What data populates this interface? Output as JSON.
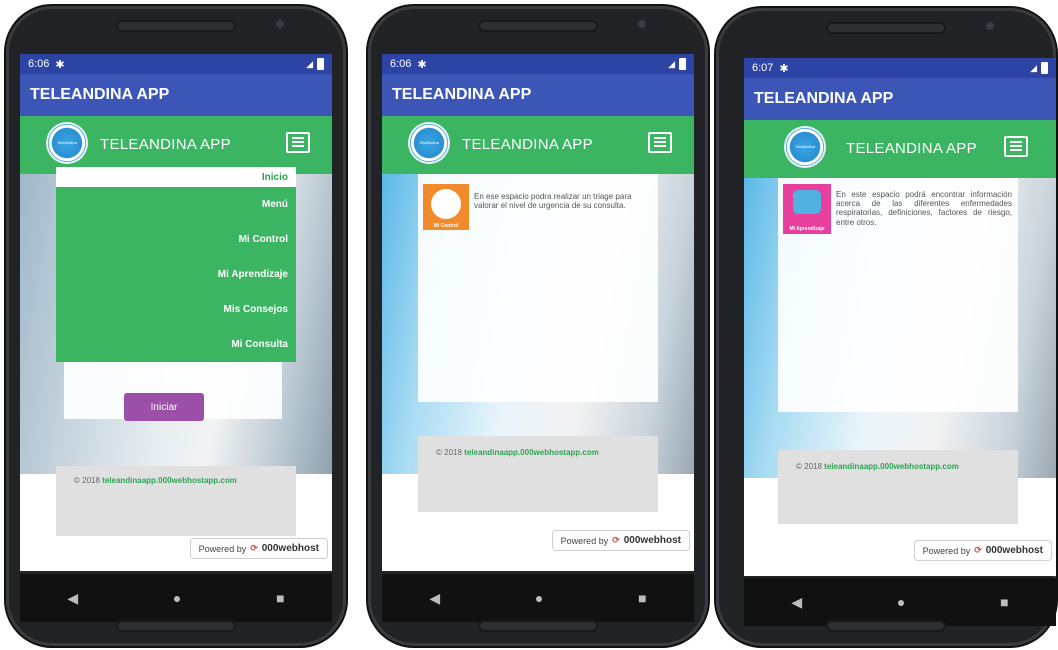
{
  "phones": [
    {
      "status_time": "6:06",
      "app_title": "TELEANDINA APP",
      "brand": "TELEANDINA APP",
      "menu": [
        {
          "label": "Inicio"
        },
        {
          "label": "Menú"
        },
        {
          "label": "Mi Control"
        },
        {
          "label": "Mi Aprendizaje"
        },
        {
          "label": "Mis Consejos"
        },
        {
          "label": "Mi Consulta"
        }
      ],
      "button": "Iniciar",
      "footer_prefix": "© 2018",
      "footer_link": "teleandinaapp.000webhostapp.com",
      "powered": "Powered by",
      "powered_brand": "000webhost"
    },
    {
      "status_time": "6:06",
      "app_title": "TELEANDINA APP",
      "brand": "TELEANDINA APP",
      "icon_label": "Mi Control",
      "description": "En ese espacio podra realizar un triage para valorar el nivel de urgencia de su consulta.",
      "footer_prefix": "© 2018",
      "footer_link": "teleandinaapp.000webhostapp.com",
      "powered": "Powered by",
      "powered_brand": "000webhost"
    },
    {
      "status_time": "6:07",
      "app_title": "TELEANDINA APP",
      "brand": "TELEANDINA APP",
      "icon_label": "Mi Aprendizaje",
      "description": "En este espacio podrá encontrar información acerca de las diferentes enfermedades respiratorias, definiciones, factores de riesgo, entre otros.",
      "footer_prefix": "© 2018",
      "footer_link": "teleandinaapp.000webhostapp.com",
      "powered": "Powered by",
      "powered_brand": "000webhost"
    }
  ],
  "colors": {
    "statusbar": "#2e44a5",
    "appbar": "#3b56b7",
    "green": "#3cb563",
    "button_purple": "#9b4fa8",
    "control_icon": "#f08a2a",
    "learn_icon": "#e83e9c"
  },
  "icons": [
    "gear-icon",
    "signal-icon",
    "battery-icon",
    "menu-icon",
    "back-icon",
    "home-icon",
    "recents-icon"
  ]
}
